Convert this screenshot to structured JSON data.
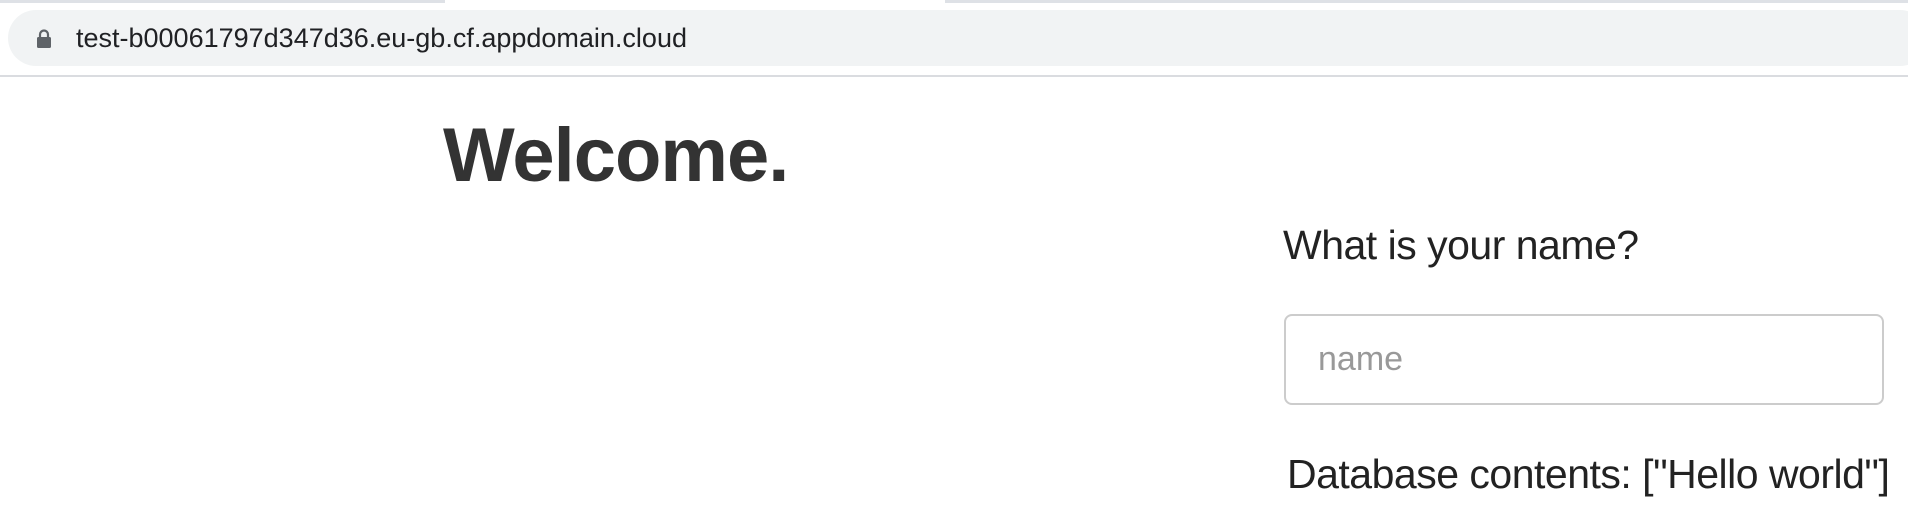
{
  "browser": {
    "url": "test-b00061797d347d36.eu-gb.cf.appdomain.cloud",
    "lock_icon": "lock-icon"
  },
  "page": {
    "title": "Welcome.",
    "question": "What is your name?",
    "name_input": {
      "placeholder": "name",
      "value": ""
    },
    "database_contents": "Database contents: [\"Hello world\"]"
  }
}
